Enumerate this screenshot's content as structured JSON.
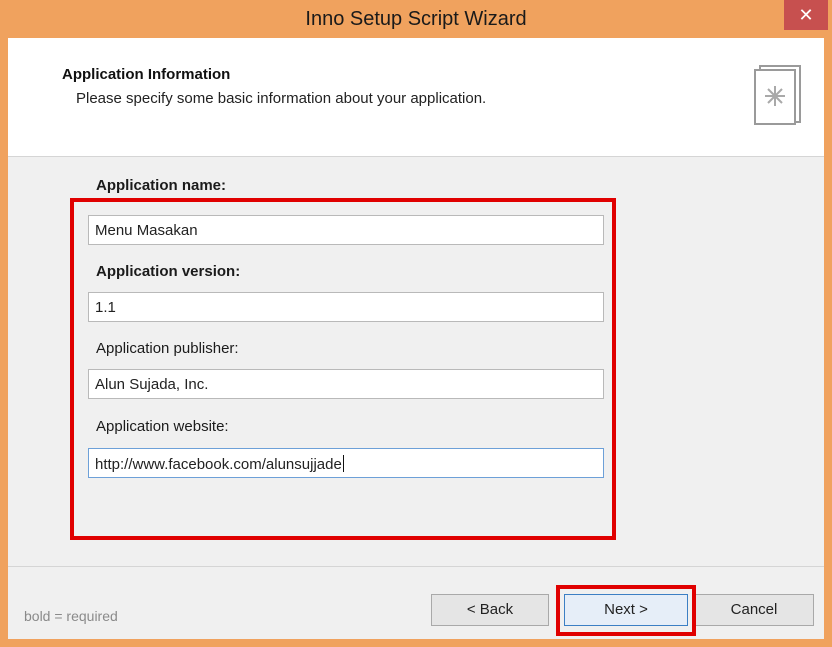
{
  "window": {
    "title": "Inno Setup Script Wizard",
    "close_glyph": "✕"
  },
  "header": {
    "title": "Application Information",
    "subtitle": "Please specify some basic information about your application."
  },
  "form": {
    "app_name": {
      "label": "Application name:",
      "value": "Menu Masakan"
    },
    "app_version": {
      "label": "Application version:",
      "value": "1.1"
    },
    "app_publisher": {
      "label": "Application publisher:",
      "value": "Alun Sujada, Inc."
    },
    "app_website": {
      "label": "Application website:",
      "value": "http://www.facebook.com/alunsujjade"
    }
  },
  "footer": {
    "note": "bold = required",
    "back_label": "< Back",
    "next_label": "Next >",
    "cancel_label": "Cancel"
  },
  "colors": {
    "titlebar": "#f0a25e",
    "close": "#c7504f",
    "highlight": "#e00000"
  }
}
